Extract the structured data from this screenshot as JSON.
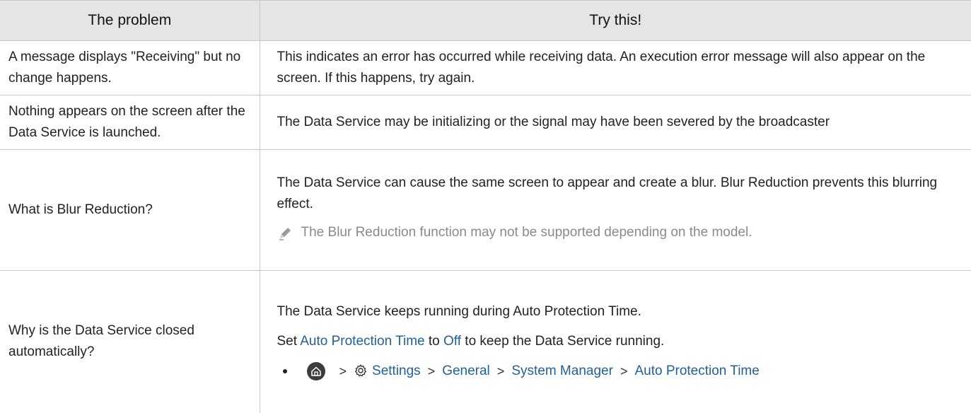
{
  "header": {
    "col1": "The problem",
    "col2": "Try this!"
  },
  "rows": [
    {
      "problem": "A message displays \"Receiving\" but no change happens.",
      "solution": "This indicates an error has occurred while receiving data. An execution error message will also appear on the screen. If this happens, try again."
    },
    {
      "problem": "Nothing appears on the screen after the Data Service is launched.",
      "solution": "The Data Service may be initializing or the signal may have been severed by the broadcaster"
    },
    {
      "problem": "What is Blur Reduction?",
      "solution": "The Data Service can cause the same screen to appear and create a blur. Blur Reduction prevents this blurring effect.",
      "note": "The Blur Reduction function may not be supported depending on the model."
    },
    {
      "problem": "Why is the Data Service closed automatically?",
      "solution_1": "The Data Service keeps running during Auto Protection Time.",
      "solution_2_pre": "Set ",
      "solution_2_link1": "Auto Protection Time",
      "solution_2_mid": " to ",
      "solution_2_link2": "Off",
      "solution_2_post": " to keep the Data Service running.",
      "path": {
        "separator": ">",
        "items": [
          "Settings",
          "General",
          "System Manager",
          "Auto Protection Time"
        ]
      }
    }
  ],
  "icons": {
    "pencil": "pencil-icon",
    "home": "home-icon",
    "settings": "gear-icon"
  },
  "colors": {
    "header_bg": "#e5e5e5",
    "link": "#1f5fa8",
    "note_text": "#8a8a8a"
  }
}
